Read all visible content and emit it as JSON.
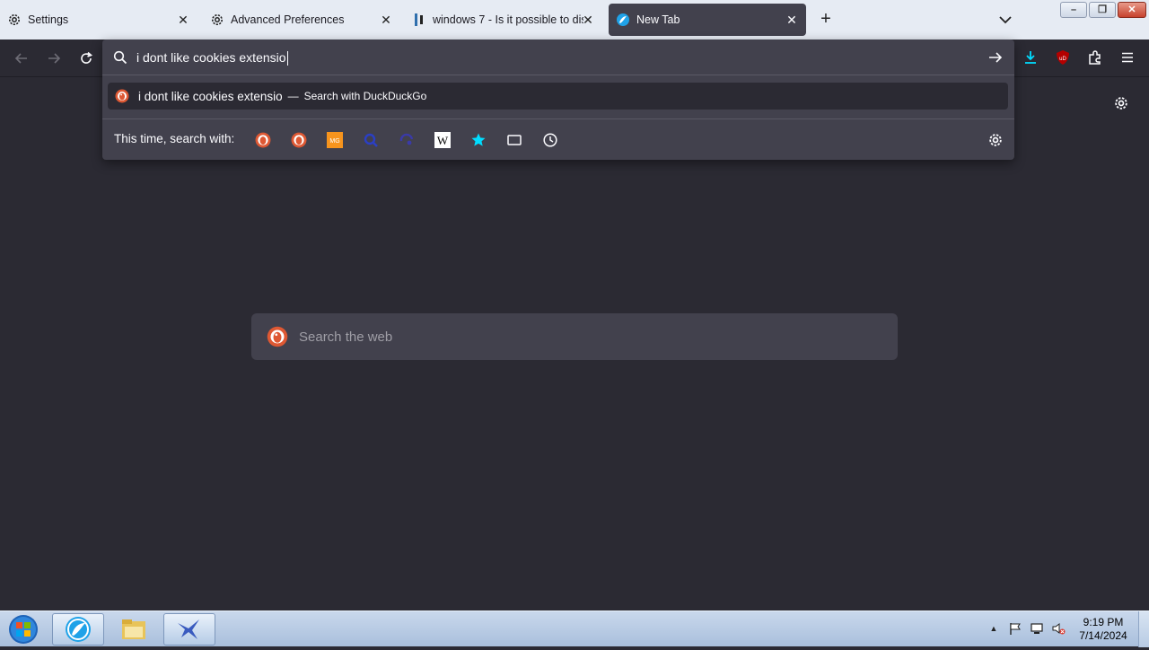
{
  "tabs": [
    {
      "label": "Settings",
      "icon": "gear-icon"
    },
    {
      "label": "Advanced Preferences",
      "icon": "gear-icon"
    },
    {
      "label": "windows 7 - Is it possible to dis",
      "icon": "superuser-icon"
    },
    {
      "label": "New Tab",
      "icon": "firefox-icon",
      "active": true
    }
  ],
  "tab_close_glyph": "✕",
  "newtab_glyph": "+",
  "window_controls": {
    "minimize": "–",
    "maximize": "❐",
    "close": "✕"
  },
  "urlbar": {
    "value": "i dont like cookies extensio"
  },
  "suggestion": {
    "query": "i dont like cookies extensio",
    "separator": "—",
    "action": "Search with DuckDuckGo"
  },
  "search_with": {
    "label": "This time, search with:",
    "engines": [
      "duckduckgo-icon",
      "duckduckgo-alt-icon",
      "mojeek-icon",
      "search-engine-blue-icon",
      "search-engine-dark-icon",
      "wikipedia-icon",
      "bookmarks-icon",
      "tabs-icon",
      "history-icon"
    ]
  },
  "web_search": {
    "placeholder": "Search the web"
  },
  "taskbar": {
    "time": "9:19 PM",
    "date": "7/14/2024",
    "tray_up_glyph": "▲"
  },
  "colors": {
    "accent": "#00ddff",
    "ddg_orange": "#de5833",
    "ublock_red": "#b40000",
    "page_bg": "#2b2a33",
    "panel_bg": "#42414d"
  }
}
